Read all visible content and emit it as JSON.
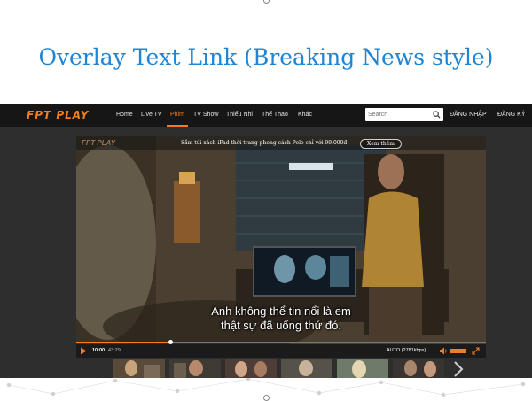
{
  "slide": {
    "title": "Overlay Text Link (Breaking News style)"
  },
  "app": {
    "logo": "FPT PLAY",
    "nav": [
      "Home",
      "Live TV",
      "Phim",
      "TV Show",
      "Thiếu Nhi",
      "Thể Thao",
      "Khác"
    ],
    "active_nav": "Phim",
    "search_placeholder": "Search",
    "login": "ĐĂNG NHẬP",
    "register": "ĐĂNG KÝ",
    "accent_color": "#f57c1f"
  },
  "player": {
    "overlay_logo": "FPT PLAY",
    "news_text": "Sắm túi xách iPad thời trang phong cách Polo chỉ với 99.000đ",
    "news_button": "Xem thêm",
    "subtitle_line1": "Anh không thể tin nổi là em",
    "subtitle_line2": "thật sự đã uống thứ đó.",
    "time_current": "10:00",
    "time_total": "43:29",
    "quality": "AUTO (2781kbps)",
    "progress": 0.23,
    "icons": [
      "play-icon",
      "volume-icon",
      "fullscreen-icon",
      "search-icon",
      "chevron-right-icon"
    ]
  }
}
